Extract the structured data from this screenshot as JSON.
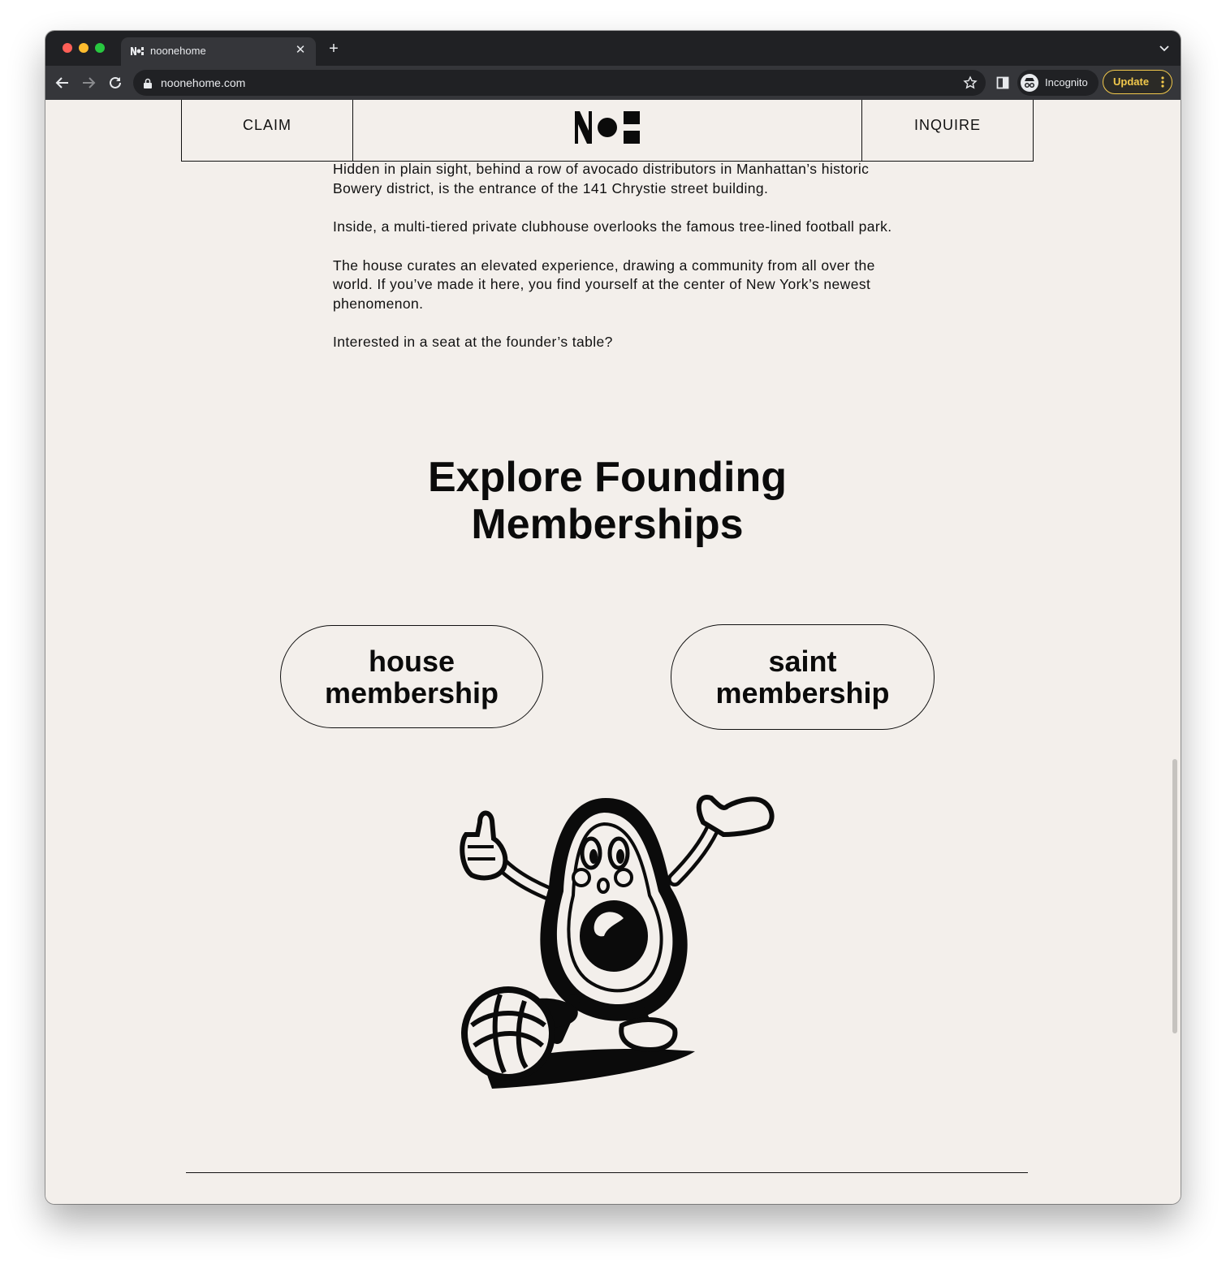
{
  "browser": {
    "tab_title": "noonehome",
    "url": "noonehome.com",
    "incognito_label": "Incognito",
    "update_label": "Update"
  },
  "site": {
    "header": {
      "claim_label": "CLAIM",
      "inquire_label": "INQUIRE"
    },
    "paragraphs": [
      "Hidden in plain sight, behind a row of avocado distributors in Manhattan’s historic Bowery district, is the entrance of the 141 Chrystie street building.",
      "Inside, a multi-tiered private clubhouse overlooks the famous tree-lined football park.",
      "The house curates an elevated experience, drawing a community from all over the world. If you’ve made it here, you find yourself at the center of New York’s newest phenomenon.",
      "Interested in a seat at the founder’s table?"
    ],
    "heading": "Explore Founding Memberships",
    "memberships": [
      {
        "label": "house membership"
      },
      {
        "label": "saint membership"
      }
    ]
  },
  "colors": {
    "page_bg": "#f3efeb",
    "ink": "#111111",
    "chrome_dark": "#202124",
    "chrome_toolbar": "#35363a",
    "update_accent": "#f2c94c"
  },
  "icons": {
    "back": "arrow-left-icon",
    "forward": "arrow-right-icon",
    "reload": "reload-icon",
    "lock": "lock-icon",
    "bookmark": "star-icon",
    "side_panel": "side-panel-icon",
    "incognito": "incognito-icon",
    "mascot": "avocado-mascot-illustration"
  }
}
